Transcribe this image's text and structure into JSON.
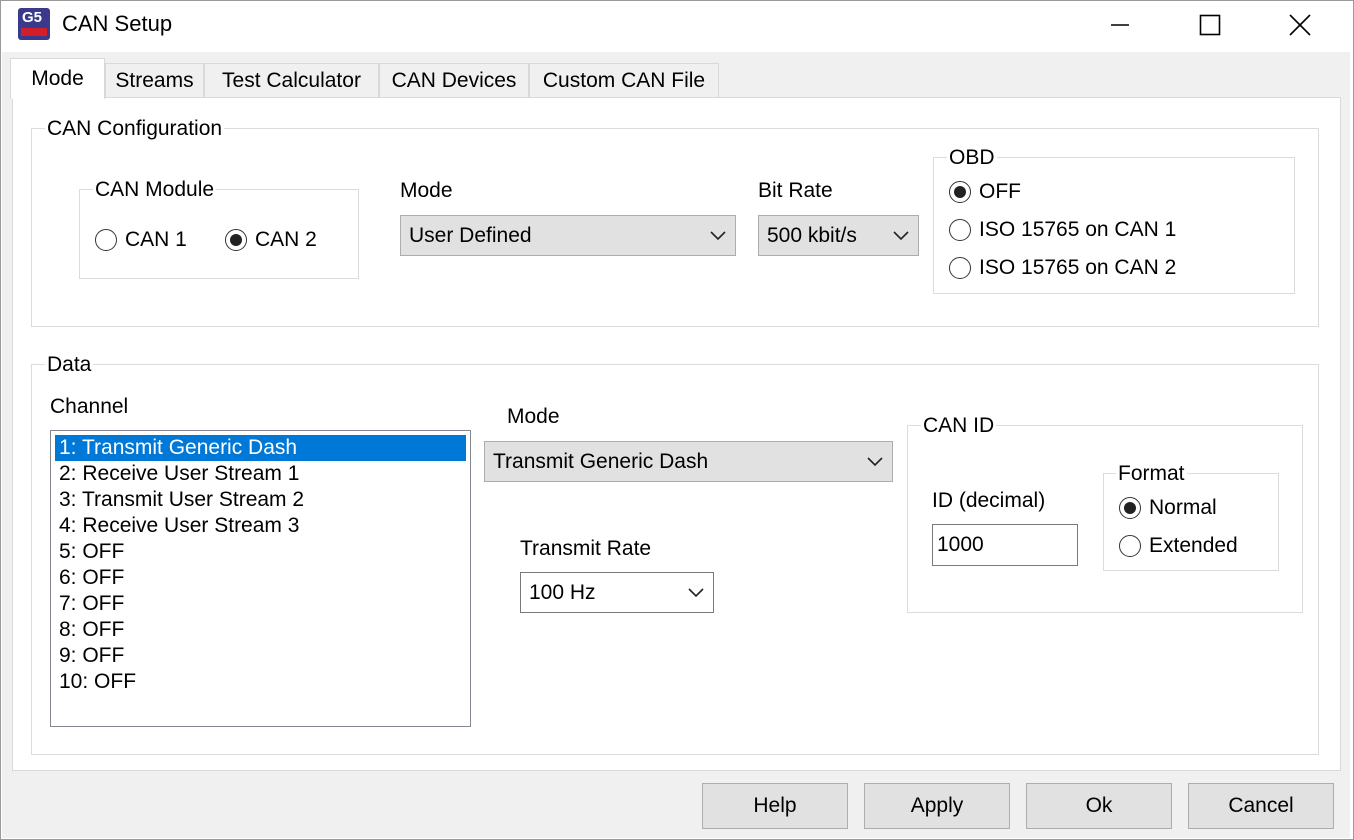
{
  "window": {
    "title": "CAN Setup",
    "icon": "g5-app-icon",
    "icon_text": "G5"
  },
  "tabs": [
    {
      "label": "Mode",
      "active": true
    },
    {
      "label": "Streams"
    },
    {
      "label": "Test Calculator"
    },
    {
      "label": "CAN Devices"
    },
    {
      "label": "Custom CAN File"
    }
  ],
  "can_config": {
    "legend": "CAN Configuration",
    "module": {
      "legend": "CAN Module",
      "options": [
        "CAN 1",
        "CAN 2"
      ],
      "selected": "CAN 2"
    },
    "mode": {
      "label": "Mode",
      "value": "User Defined"
    },
    "bitrate": {
      "label": "Bit Rate",
      "value": "500 kbit/s"
    },
    "obd": {
      "legend": "OBD",
      "options": [
        "OFF",
        "ISO 15765 on CAN 1",
        "ISO 15765 on CAN 2"
      ],
      "selected": "OFF"
    }
  },
  "data": {
    "legend": "Data",
    "channel_label": "Channel",
    "channels": [
      "1: Transmit Generic Dash",
      "2: Receive User Stream 1",
      "3: Transmit User Stream 2",
      "4: Receive User Stream 3",
      "5: OFF",
      "6: OFF",
      "7: OFF",
      "8: OFF",
      "9: OFF",
      "10: OFF"
    ],
    "selected_channel": "1: Transmit Generic Dash",
    "mode": {
      "label": "Mode",
      "value": "Transmit Generic Dash"
    },
    "transmit_rate": {
      "label": "Transmit Rate",
      "value": "100 Hz"
    },
    "can_id": {
      "legend": "CAN ID",
      "id_label": "ID (decimal)",
      "id_value": "1000",
      "format": {
        "legend": "Format",
        "options": [
          "Normal",
          "Extended"
        ],
        "selected": "Normal"
      }
    }
  },
  "buttons": {
    "help": "Help",
    "apply": "Apply",
    "ok": "Ok",
    "cancel": "Cancel"
  },
  "colors": {
    "selection": "#0078d7",
    "app_icon_bg": "#3a3a8c",
    "app_icon_stripe": "#d21f2a"
  }
}
